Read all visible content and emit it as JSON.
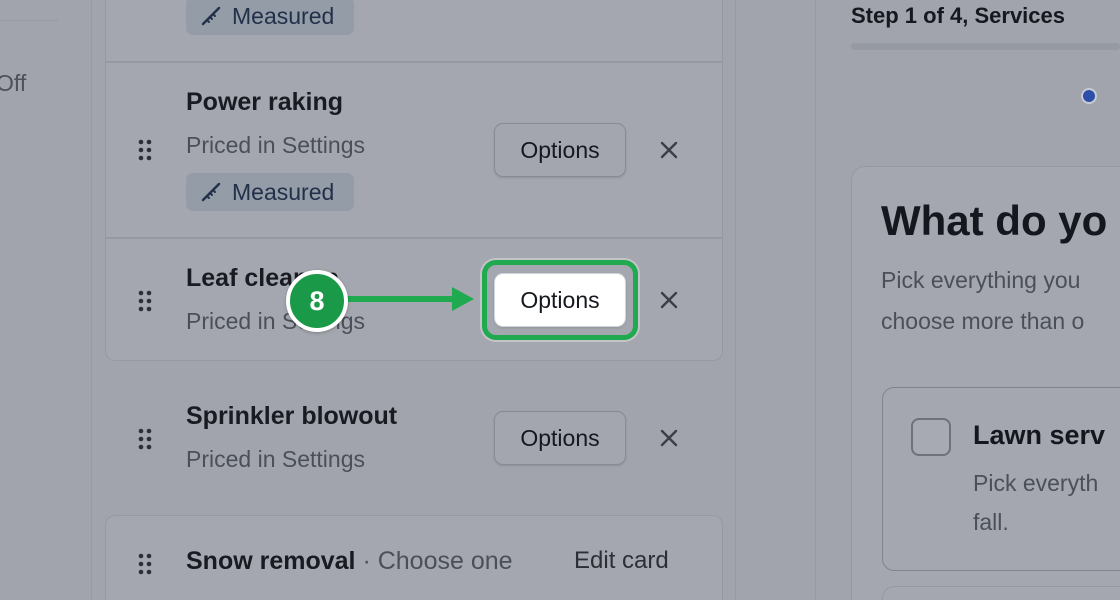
{
  "left_panel": {
    "toggle_text": "Off"
  },
  "services": [
    {
      "title": "",
      "subtitle": "",
      "badge": "Measured"
    },
    {
      "title": "Power raking",
      "subtitle": "Priced in Settings",
      "badge": "Measured",
      "options_label": "Options"
    },
    {
      "title": "Leaf cleanup",
      "subtitle": "Priced in Settings",
      "options_label": "Options"
    },
    {
      "title": "Sprinkler blowout",
      "subtitle": "Priced in Settings",
      "options_label": "Options"
    }
  ],
  "snow_card": {
    "title": "Snow removal",
    "separator": " · ",
    "mode": "Choose one",
    "edit_label": "Edit card"
  },
  "annotation": {
    "step_number": "8",
    "color": "#1faa4f"
  },
  "preview": {
    "step_label": "Step 1 of 4, Services",
    "question_title": "What do yo",
    "question_sub_line1": "Pick everything you",
    "question_sub_line2": "choose more than o",
    "option_title": "Lawn serv",
    "option_desc_line1": "Pick everyth",
    "option_desc_line2": "fall."
  },
  "icons": {
    "measure": "ruler-icon",
    "drag": "drag-handle-icon",
    "remove": "close-icon"
  },
  "colors": {
    "accent_green": "#1faa4f",
    "step_dot": "#2d4fa8"
  }
}
